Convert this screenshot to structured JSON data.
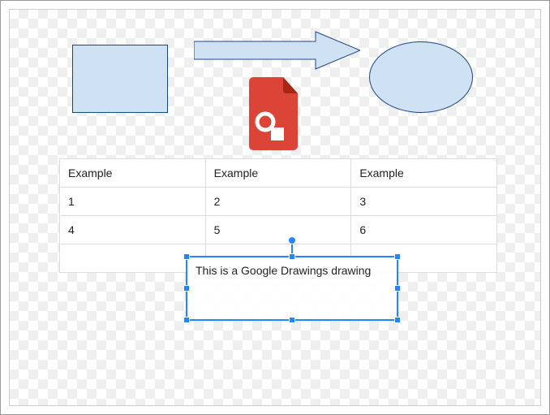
{
  "shapes": {
    "rectangle": {
      "fill": "#cfe2f3",
      "stroke": "#1c4587"
    },
    "arrow": {
      "fill": "#cfe2f3",
      "stroke": "#1c4587"
    },
    "ellipse": {
      "fill": "#cfe2f3",
      "stroke": "#1c4587"
    }
  },
  "icon": {
    "name": "google-drawings",
    "color": "#db4437"
  },
  "table": {
    "headers": [
      "Example",
      "Example",
      "Example"
    ],
    "rows": [
      [
        "1",
        "2",
        "3"
      ],
      [
        "4",
        "5",
        "6"
      ],
      [
        "",
        "",
        ""
      ]
    ]
  },
  "textbox": {
    "text": "This is a Google Drawings drawing",
    "selected": true
  }
}
